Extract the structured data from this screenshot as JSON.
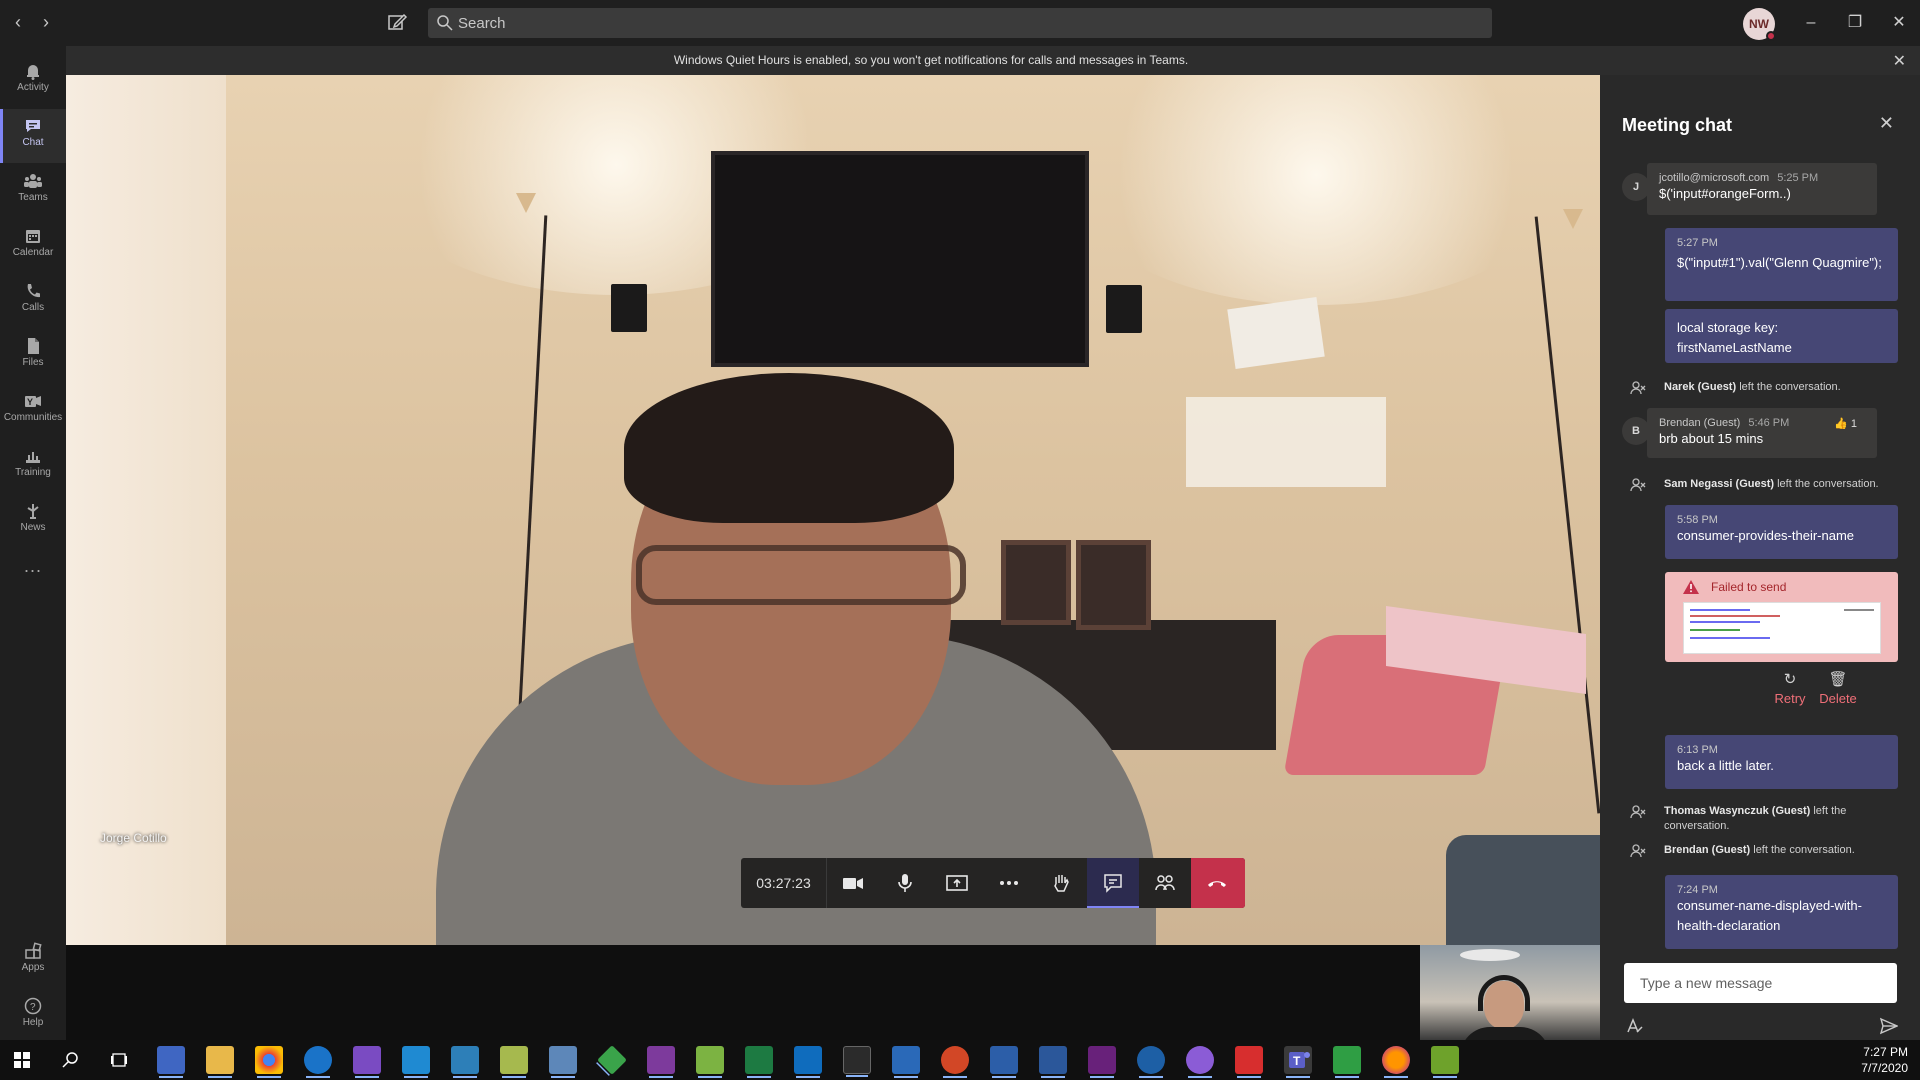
{
  "topbar": {
    "search_placeholder": "Search",
    "user_initials": "NW"
  },
  "rail": {
    "items": [
      {
        "label": "Activity",
        "icon": "bell-icon"
      },
      {
        "label": "Chat",
        "icon": "chat-icon",
        "active": true
      },
      {
        "label": "Teams",
        "icon": "teams-icon"
      },
      {
        "label": "Calendar",
        "icon": "calendar-icon"
      },
      {
        "label": "Calls",
        "icon": "phone-icon"
      },
      {
        "label": "Files",
        "icon": "file-icon"
      },
      {
        "label": "Communities",
        "icon": "communities-icon"
      },
      {
        "label": "Training",
        "icon": "training-icon"
      },
      {
        "label": "News",
        "icon": "news-icon"
      }
    ],
    "more": "...",
    "apps_label": "Apps",
    "help_label": "Help"
  },
  "banner": {
    "message": "Windows Quiet Hours is enabled, so you won't get notifications for calls and messages in Teams."
  },
  "call": {
    "caller_name": "Jorge Cotillo",
    "duration": "03:27:23"
  },
  "chat": {
    "title": "Meeting chat",
    "messages": [
      {
        "sender": "jcotillo@microsoft.com",
        "avatar": "J",
        "time": "5:25 PM",
        "text": "$('input#orangeForm..)"
      },
      {
        "time": "5:27 PM",
        "text": "$(\"input#1\").val(\"Glenn Quagmire\");"
      },
      {
        "text": "local storage key: firstNameLastName"
      },
      {
        "sys_name": "Narek (Guest)",
        "sys_text": "left the conversation."
      },
      {
        "sender": "Brendan (Guest)",
        "avatar": "B",
        "time": "5:46 PM",
        "text": "brb about 15 mins",
        "reaction": "1"
      },
      {
        "sys_name": "Sam Negassi (Guest)",
        "sys_text": "left the conversation."
      },
      {
        "time": "5:58 PM",
        "text": "consumer-provides-their-name"
      },
      {
        "failed_text": "Failed to send",
        "retry": "Retry",
        "delete": "Delete"
      },
      {
        "time": "6:13 PM",
        "text": "back a little later."
      },
      {
        "sys_name": "Thomas Wasynczuk (Guest)",
        "sys_text": "left the conversation."
      },
      {
        "sys_name": "Brendan (Guest)",
        "sys_text": "left the conversation."
      },
      {
        "time": "7:24 PM",
        "text": "consumer-name-displayed-with-health-declaration"
      }
    ],
    "composer_placeholder": "Type a new message"
  },
  "taskbar": {
    "time": "7:27 PM",
    "date": "7/7/2020"
  },
  "colors": {
    "accent": "#7f85f5",
    "hangup": "#c4314b",
    "failed_bg": "#f1bbbc"
  }
}
